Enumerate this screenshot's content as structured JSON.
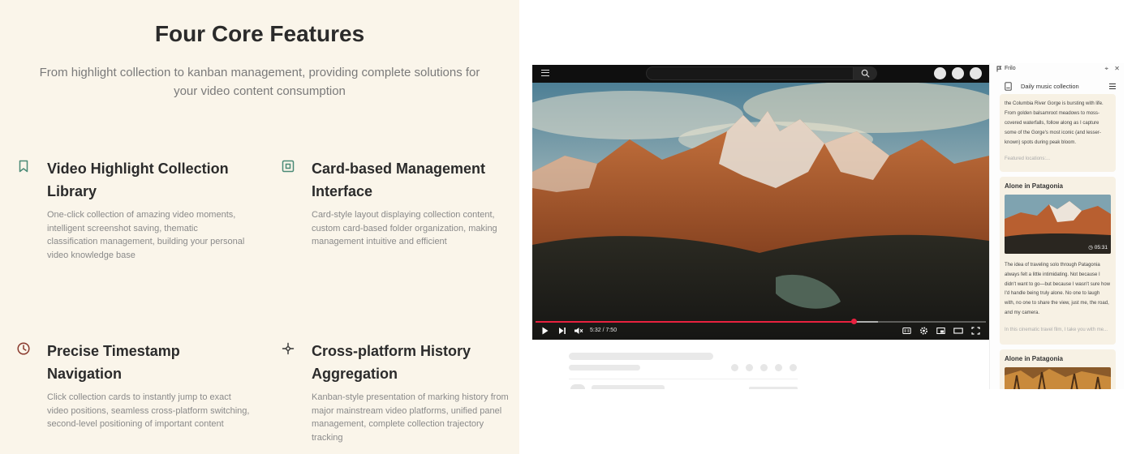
{
  "features_section": {
    "title": "Four Core Features",
    "subtitle": "From highlight collection to kanban management, providing complete solutions for your video content consumption",
    "accent_color": "#4a8a76",
    "features": [
      {
        "title": "Video Highlight Collection Library",
        "description": "One-click collection of amazing video moments, intelligent screenshot saving, thematic classification management, building your personal video knowledge base",
        "icon": "bookmark-icon"
      },
      {
        "title": "Card-based Management Interface",
        "description": "Card-style layout displaying collection content, custom card-based folder organization, making management intuitive and efficient",
        "icon": "card-icon"
      },
      {
        "title": "Precise Timestamp Navigation",
        "description": "Click collection cards to instantly jump to exact video positions, seamless cross-platform switching, second-level positioning of important content",
        "icon": "clock-icon"
      },
      {
        "title": "Cross-platform History Aggregation",
        "description": "Kanban-style presentation of marking history from major mainstream video platforms, unified panel management, complete collection trajectory tracking",
        "icon": "crosshair-icon"
      }
    ]
  },
  "video_player": {
    "time_display": "5:32 / 7:50",
    "progress": 0.708,
    "buffered": 0.76,
    "progress_color": "#e8213f"
  },
  "side_panel": {
    "app_name": "Frilo",
    "folder_name": "Daily music collection",
    "cards": [
      {
        "text": "the Columbia River Gorge is bursting with life. From golden balsamroot meadows to moss-covered waterfalls, follow along as I capture some of the Gorge's most iconic (and lesser-known) spots during peak bloom.",
        "footer": "Featured locations:..."
      },
      {
        "title": "Alone in Patagonia",
        "duration": "05:31",
        "text": "The idea of traveling solo through Patagonia always felt a little intimidating. Not because I didn't want to go—but because I wasn't sure how I'd handle being truly alone. No one to laugh with, no one to share the view, just me, the road, and my camera.",
        "footer": "In this cinematic travel film, I take you with me..."
      },
      {
        "title": "Alone in Patagonia"
      }
    ]
  }
}
